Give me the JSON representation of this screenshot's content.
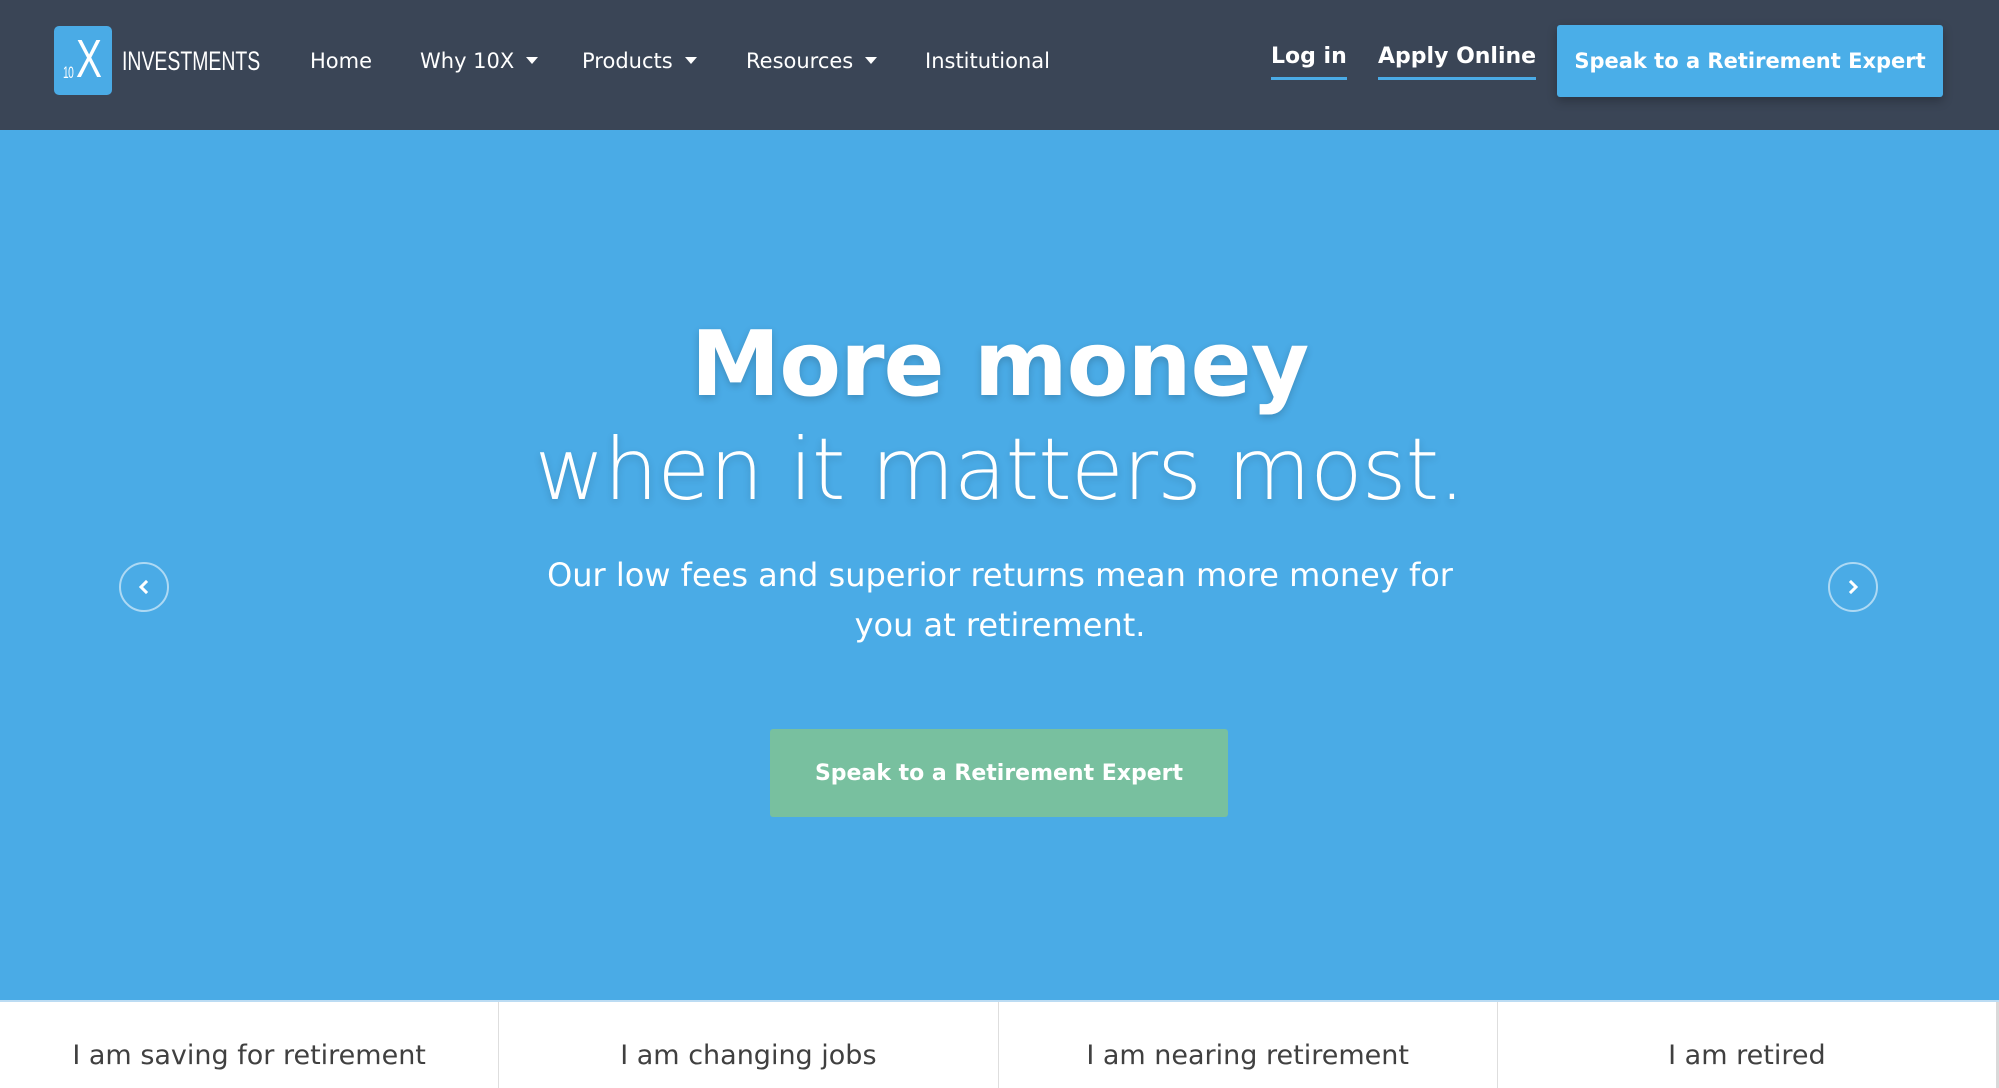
{
  "brand": {
    "logo_small": "10",
    "logo_large": "X",
    "wordmark": "INVESTMENTS"
  },
  "nav": {
    "items": [
      {
        "label": "Home",
        "has_dropdown": false
      },
      {
        "label": "Why 10X",
        "has_dropdown": true
      },
      {
        "label": "Products",
        "has_dropdown": true
      },
      {
        "label": "Resources",
        "has_dropdown": true
      },
      {
        "label": "Institutional",
        "has_dropdown": false
      }
    ],
    "login_label": "Log in",
    "apply_label": "Apply Online",
    "cta_label": "Speak to a Retirement Expert"
  },
  "hero": {
    "title": "More money",
    "subtitle": "when it matters most.",
    "description": "Our low fees and superior returns mean more money for you at retirement.",
    "cta_label": "Speak to a Retirement Expert",
    "prev_icon": "chevron-left-icon",
    "next_icon": "chevron-right-icon"
  },
  "personas": [
    {
      "label": "I am saving for retirement"
    },
    {
      "label": "I am changing jobs"
    },
    {
      "label": "I am nearing retirement"
    },
    {
      "label": "I am retired"
    }
  ],
  "colors": {
    "header_bg": "#3a4556",
    "hero_bg": "#4aabe6",
    "accent_blue": "#4aaee8",
    "cta_green": "#78c09f",
    "persona_text": "#404040"
  }
}
